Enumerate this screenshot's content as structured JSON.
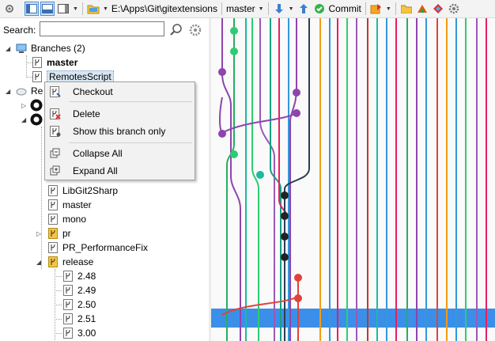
{
  "toolbar": {
    "repo_path": "E:\\Apps\\Git\\gitextensions",
    "branch": "master",
    "commit_label": "Commit"
  },
  "search": {
    "label": "Search:",
    "value": ""
  },
  "tree": {
    "branches_header": "Branches (2)",
    "branches": [
      "master",
      "RemotesScript"
    ],
    "remotes_header_partial": "Re",
    "remote_branches": [
      "LibGit2Sharp",
      "master",
      "mono",
      "pr",
      "PR_PerformanceFix",
      "release"
    ],
    "release_children": [
      "2.48",
      "2.49",
      "2.50",
      "2.51",
      "3.00"
    ]
  },
  "context_menu": {
    "items": [
      "Checkout",
      "Delete",
      "Show this branch only",
      "Collapse All",
      "Expand All"
    ]
  },
  "colors": {
    "selected_row": "#3b8fe8",
    "lane_colors": [
      "#e0433a",
      "#8e44ad",
      "#2ecc71",
      "#27ae60",
      "#1abc9c",
      "#3498db",
      "#9b59b6",
      "#e91e63",
      "#f39c12",
      "#2c3e50",
      "#c0392b",
      "#16a085"
    ]
  }
}
